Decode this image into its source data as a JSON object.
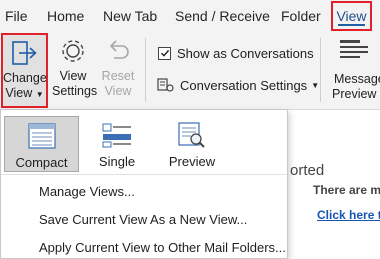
{
  "tabs": {
    "file": "File",
    "home": "Home",
    "new_tab": "New Tab",
    "send_receive": "Send / Receive",
    "folder": "Folder",
    "view": "View"
  },
  "ribbon": {
    "change_view": {
      "line1": "Change",
      "line2": "View",
      "icon": "change-view-arrow-icon"
    },
    "view_settings": {
      "line1": "View",
      "line2": "Settings",
      "icon": "gear-icon"
    },
    "reset_view": {
      "line1": "Reset",
      "line2": "View",
      "icon": "undo-icon"
    },
    "show_as_conversations": {
      "label": "Show as Conversations",
      "checked": true
    },
    "conversation_settings": {
      "label": "Conversation Settings",
      "icon": "conversation-settings-icon"
    },
    "message_preview": {
      "line1": "Message",
      "line2": "Preview"
    }
  },
  "background": {
    "heading_fragment": "orted",
    "info_fragment": "There are mo",
    "link_fragment": "Click here to"
  },
  "menu": {
    "gallery": [
      {
        "label": "Compact",
        "icon": "compact-view-icon",
        "selected": true
      },
      {
        "label": "Single",
        "icon": "single-view-icon",
        "selected": false
      },
      {
        "label": "Preview",
        "icon": "preview-view-icon",
        "selected": false
      }
    ],
    "items": [
      {
        "label": "Manage Views...",
        "underline_char": "V"
      },
      {
        "label": "Save Current View As a New View...",
        "underline_char": "S"
      },
      {
        "label": "Apply Current View to Other Mail Folders...",
        "underline_char": "A"
      }
    ]
  },
  "colors": {
    "highlight_border": "#e0202a",
    "accent_blue": "#1f5fa8",
    "link_blue": "#1a55b4",
    "ribbon_bg": "#f3f3f3",
    "selected_bg": "#d6d6d6"
  }
}
